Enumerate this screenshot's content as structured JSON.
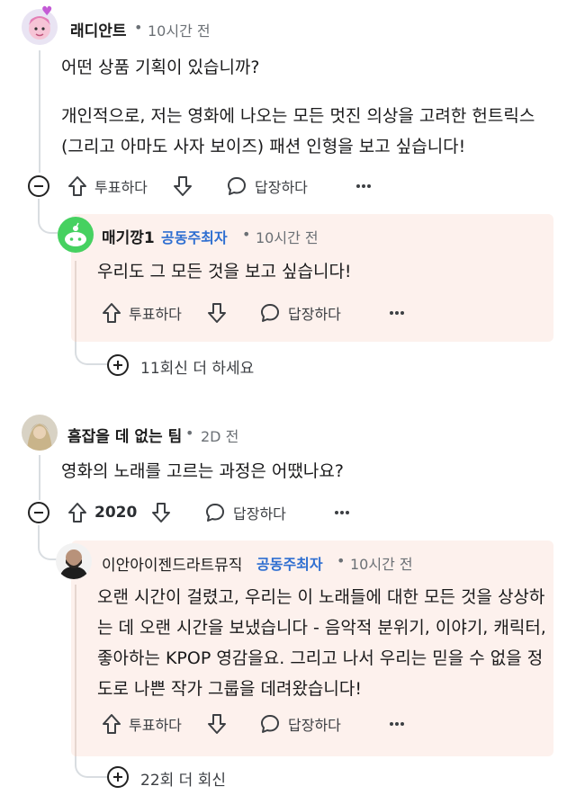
{
  "comments": [
    {
      "username": "래디안트",
      "time": "10시간 전",
      "paragraphs": [
        "어떤 상품 기획이 있습니까?",
        "개인적으로, 저는 영화에 나오는 모든 멋진 의상을 고려한 헌트릭스(그리고 아마도 사자 보이즈) 패션 인형을 보고 싶습니다!"
      ],
      "vote_label": "투표하다",
      "reply_label": "답장하다",
      "more_icon": "more-options-icon",
      "reply": {
        "username": "매기깡1",
        "flair": "공동주최자",
        "time": "10시간 전",
        "text": "우리도 그 모든 것을 보고 싶습니다!",
        "vote_label": "투표하다",
        "reply_label": "답장하다"
      },
      "more_replies": "11회신 더 하세요"
    },
    {
      "username": "흠잡을 데 없는 팀",
      "time": "2D 전",
      "text": "영화의 노래를 고르는 과정은 어땠나요?",
      "vote_count": "2020",
      "reply_label": "답장하다",
      "reply": {
        "username": "이안아이젠드라트뮤직",
        "flair": "공동주최자",
        "time": "10시간 전",
        "text": "오랜 시간이 걸렸고, 우리는 이 노래들에 대한 모든 것을 상상하는 데 오랜 시간을 보냈습니다 - 음악적 분위기, 이야기, 캐릭터, 좋아하는 KPOP 영감을요. 그리고 나서 우리는 믿을 수 없을 정도로 나쁜 작가 그룹을 데려왔습니다!",
        "vote_label": "투표하다",
        "reply_label": "답장하다"
      },
      "more_replies": "22회 더 회신"
    }
  ],
  "separator": "•",
  "colors": {
    "reply_bg": "#fdf1ed",
    "flair": "#2f6fd1",
    "thread_line": "#d9dde1"
  }
}
